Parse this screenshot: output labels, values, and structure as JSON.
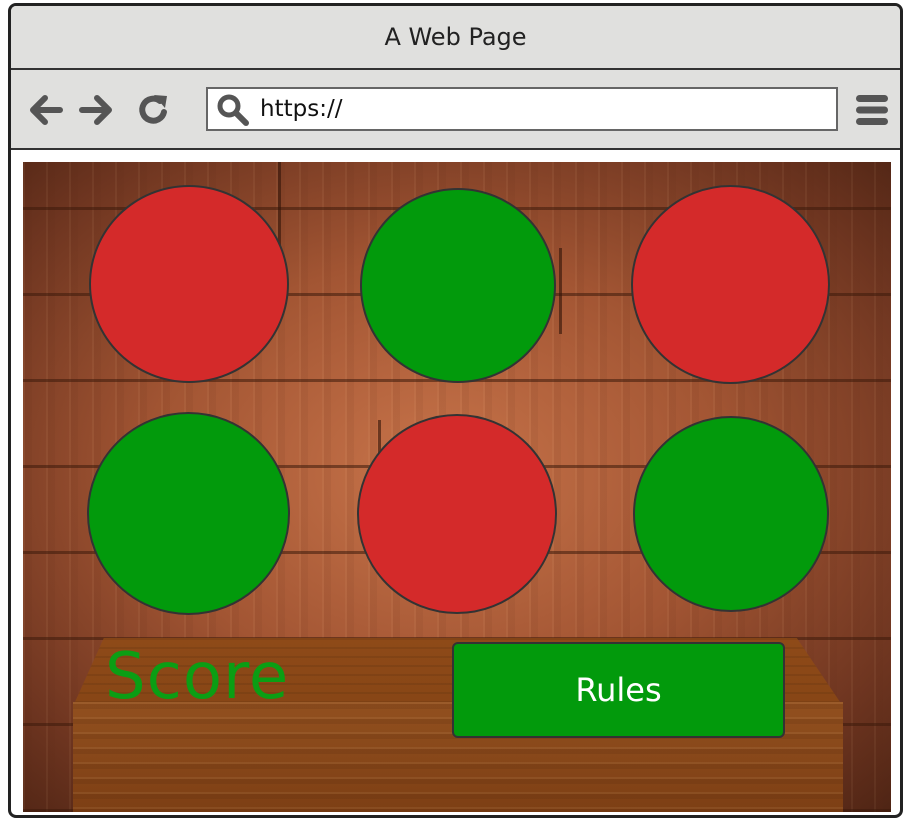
{
  "window": {
    "title": "A Web Page"
  },
  "toolbar": {
    "back_icon": "arrow-left-icon",
    "forward_icon": "arrow-right-icon",
    "refresh_icon": "refresh-icon",
    "search_icon": "search-icon",
    "url": "https://",
    "menu_icon": "hamburger-menu-icon"
  },
  "colors": {
    "red": "#d42a2a",
    "green": "#029a0c",
    "score_text": "#0b9e14",
    "button": "#029a0c"
  },
  "game": {
    "circles": [
      {
        "color": "red"
      },
      {
        "color": "green"
      },
      {
        "color": "red"
      },
      {
        "color": "green"
      },
      {
        "color": "red"
      },
      {
        "color": "green"
      }
    ],
    "score_label": "Score",
    "rules_button": "Rules"
  }
}
